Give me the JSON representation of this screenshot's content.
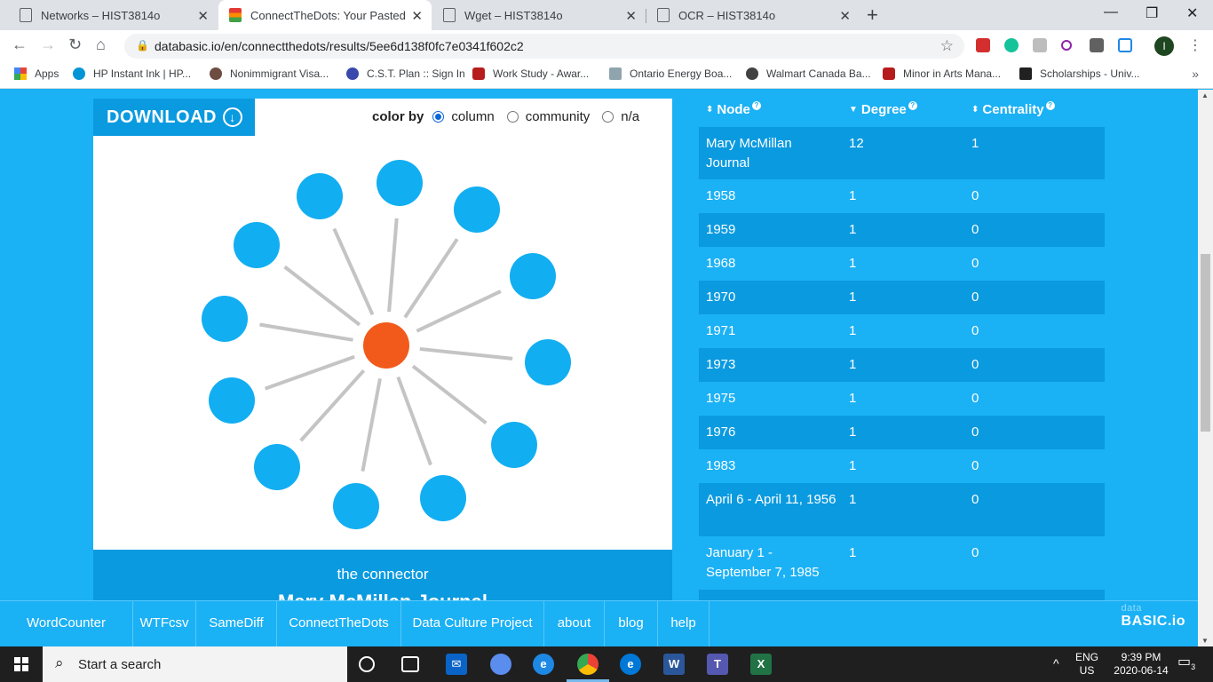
{
  "browser": {
    "tabs": [
      {
        "title": "Networks – HIST3814o",
        "active": false
      },
      {
        "title": "ConnectTheDots: Your Pasted Da",
        "active": true
      },
      {
        "title": "Wget – HIST3814o",
        "active": false
      },
      {
        "title": "OCR – HIST3814o",
        "active": false
      }
    ],
    "url": "databasic.io/en/connectthedots/results/5ee6d138f0fc7e0341f602c2",
    "profile_initial": "I",
    "bookmarks": [
      {
        "label": "Apps",
        "icon_color": "#ea4335"
      },
      {
        "label": "HP Instant Ink | HP...",
        "icon_color": "#0096d6"
      },
      {
        "label": "Nonimmigrant Visa...",
        "icon_color": "#6d4c41"
      },
      {
        "label": "C.S.T. Plan :: Sign In",
        "icon_color": "#3949ab"
      },
      {
        "label": "Work Study - Awar...",
        "icon_color": "#b71c1c"
      },
      {
        "label": "Ontario Energy Boa...",
        "icon_color": "#90a4ae"
      },
      {
        "label": "Walmart Canada Ba...",
        "icon_color": "#424242"
      },
      {
        "label": "Minor in Arts Mana...",
        "icon_color": "#b71c1c"
      },
      {
        "label": "Scholarships - Univ...",
        "icon_color": "#212121"
      }
    ]
  },
  "page": {
    "download_label": "DOWNLOAD",
    "color_by_label": "color by",
    "color_options": [
      {
        "label": "column",
        "selected": true
      },
      {
        "label": "community",
        "selected": false
      },
      {
        "label": "n/a",
        "selected": false
      }
    ],
    "node_color": "#12aef2",
    "hub_color": "#f15a1a",
    "connector_label": "the connector",
    "connector_name": "Mary McMillan Journal",
    "table": {
      "headers": [
        "Node",
        "Degree",
        "Centrality"
      ],
      "rows": [
        {
          "node": "Mary McMillan Journal",
          "degree": "12",
          "centrality": "1"
        },
        {
          "node": "1958",
          "degree": "1",
          "centrality": "0"
        },
        {
          "node": "1959",
          "degree": "1",
          "centrality": "0"
        },
        {
          "node": "1968",
          "degree": "1",
          "centrality": "0"
        },
        {
          "node": "1970",
          "degree": "1",
          "centrality": "0"
        },
        {
          "node": "1971",
          "degree": "1",
          "centrality": "0"
        },
        {
          "node": "1973",
          "degree": "1",
          "centrality": "0"
        },
        {
          "node": "1975",
          "degree": "1",
          "centrality": "0"
        },
        {
          "node": "1976",
          "degree": "1",
          "centrality": "0"
        },
        {
          "node": "1983",
          "degree": "1",
          "centrality": "0"
        },
        {
          "node": "April 6 - April 11, 1956",
          "degree": "1",
          "centrality": "0"
        },
        {
          "node": "January 1 - September 7, 1985",
          "degree": "1",
          "centrality": "0"
        }
      ]
    },
    "footer_nav": [
      "WordCounter",
      "WTFcsv",
      "SameDiff",
      "ConnectTheDots",
      "Data Culture Project",
      "about",
      "blog",
      "help"
    ],
    "brand_small": "data",
    "brand": "BASIC.io"
  },
  "taskbar": {
    "search_placeholder": "Start a search",
    "lang": "ENG",
    "region": "US",
    "time": "9:39 PM",
    "date": "2020-06-14",
    "notification_count": "3"
  }
}
